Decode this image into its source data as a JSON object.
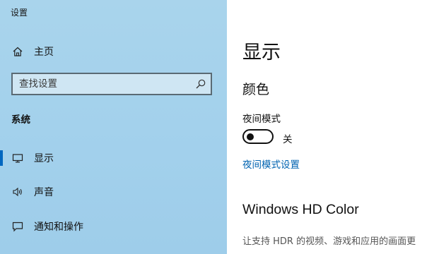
{
  "window": {
    "title": "设置"
  },
  "sidebar": {
    "home_label": "主页",
    "search": {
      "placeholder": "查找设置",
      "value": ""
    },
    "section_title": "系统",
    "items": [
      {
        "label": "显示",
        "icon": "monitor-icon",
        "active": true
      },
      {
        "label": "声音",
        "icon": "speaker-icon",
        "active": false
      },
      {
        "label": "通知和操作",
        "icon": "notification-icon",
        "active": false
      }
    ]
  },
  "main": {
    "page_title": "显示",
    "color_section": {
      "heading": "颜色",
      "night_light_label": "夜间模式",
      "night_light_state": "关",
      "night_light_settings_link": "夜间模式设置"
    },
    "hd_color": {
      "heading": "Windows HD Color",
      "description": "让支持 HDR 的视频、游戏和应用的画面更"
    }
  },
  "colors": {
    "accent": "#0067c0",
    "link": "#0063b1",
    "sidebar_background": "#a3d1ec"
  }
}
